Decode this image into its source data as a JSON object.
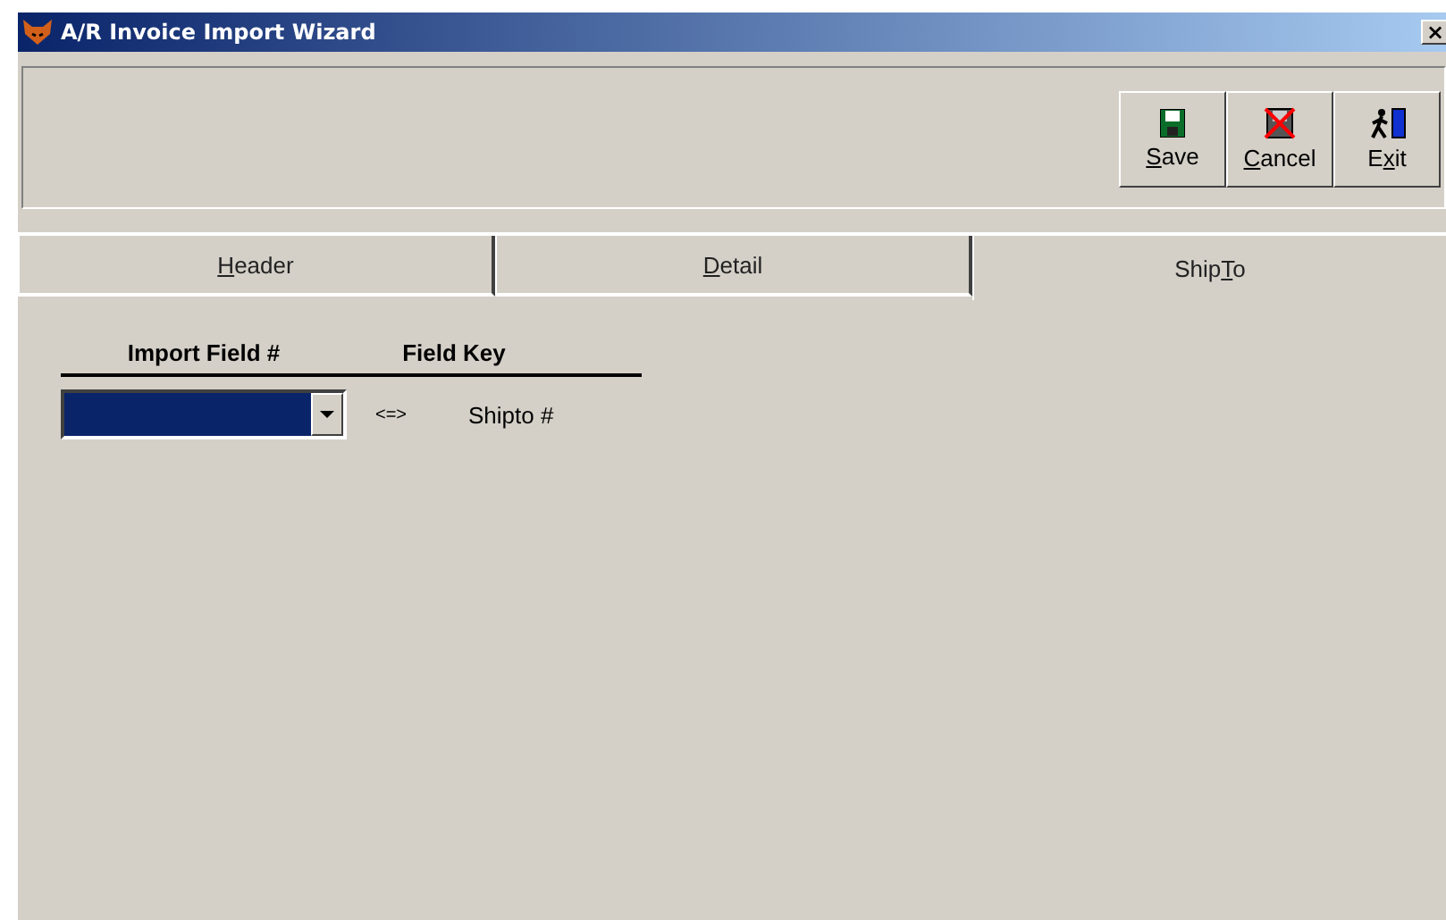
{
  "window": {
    "title": "A/R Invoice Import Wizard",
    "close": "×"
  },
  "toolbar": {
    "buttons": [
      {
        "kind": "save",
        "key": "S",
        "after": "ave"
      },
      {
        "kind": "cancel",
        "key": "C",
        "after": "ancel"
      },
      {
        "kind": "exit",
        "before": "E",
        "key": "x",
        "after": "it"
      }
    ]
  },
  "tabs": [
    {
      "key": "H",
      "after": "eader",
      "selected": false
    },
    {
      "key": "D",
      "after": "etail",
      "selected": false
    },
    {
      "before": "Ship",
      "key": "T",
      "after": "o",
      "selected": true
    }
  ],
  "mapping": {
    "columns": [
      "Import Field #",
      "Field Key"
    ],
    "rows": [
      {
        "selected": true,
        "arrow": "<=>",
        "key": "Shipto #"
      }
    ]
  }
}
